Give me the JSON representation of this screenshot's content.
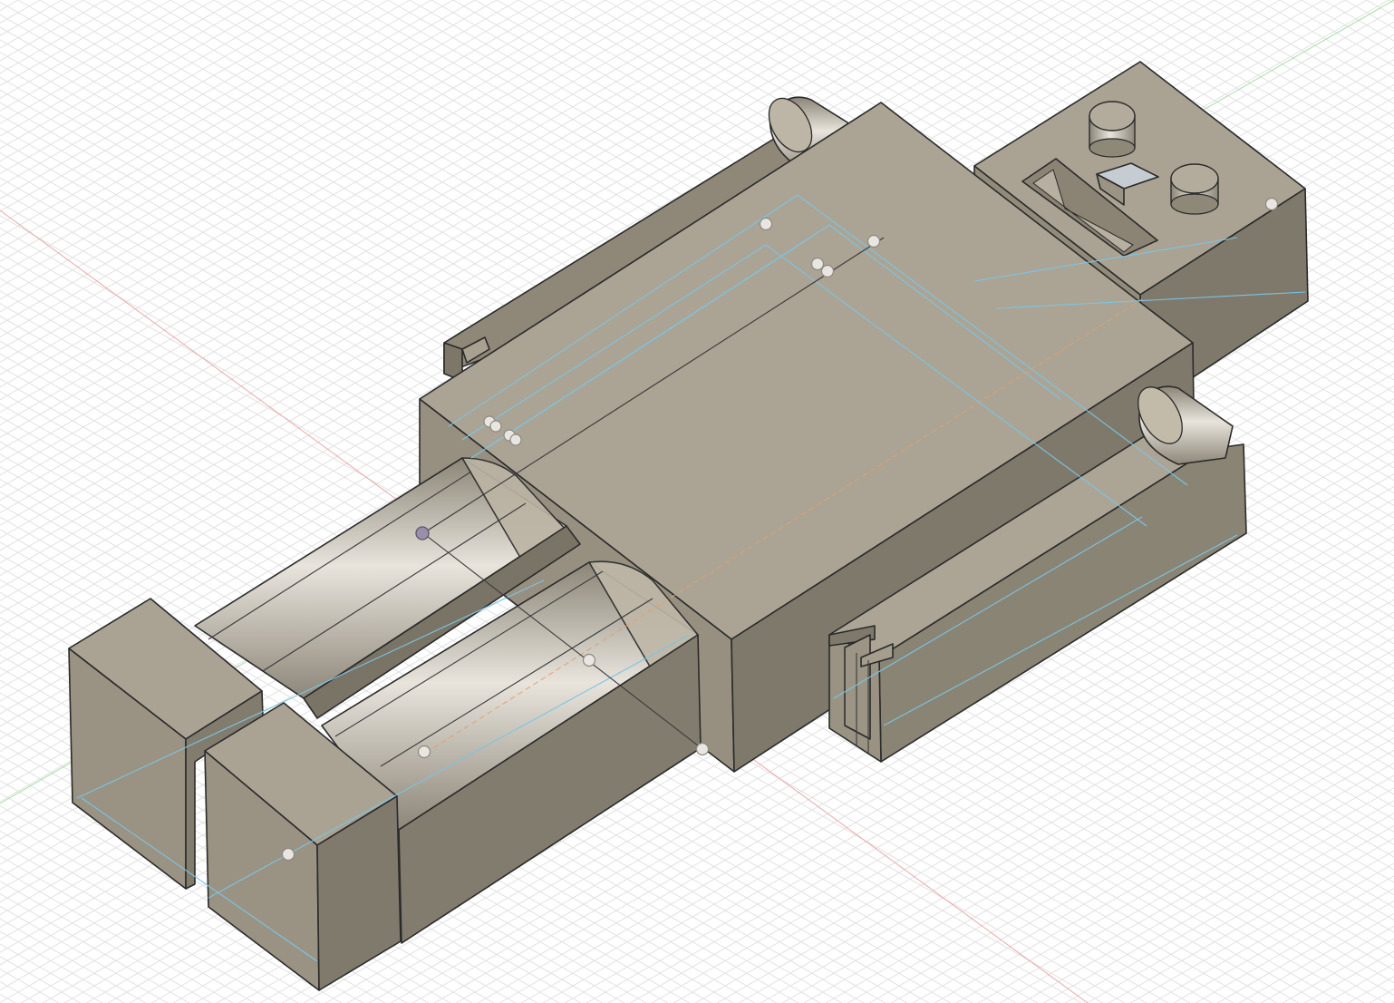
{
  "app": "CAD viewport",
  "view": "isometric",
  "colors": {
    "background": "#ffffff",
    "grid": "#e1e1e1",
    "axis_red": "#e8a3a3",
    "axis_green": "#a7d9a7",
    "body_top": "#aca596",
    "body_left": "#97907f",
    "body_right": "#7e786a",
    "sketch_line": "#7cc4e4",
    "construction_line": "#e0a070"
  },
  "icons": [
    "sketch-point",
    "edge-outline"
  ]
}
